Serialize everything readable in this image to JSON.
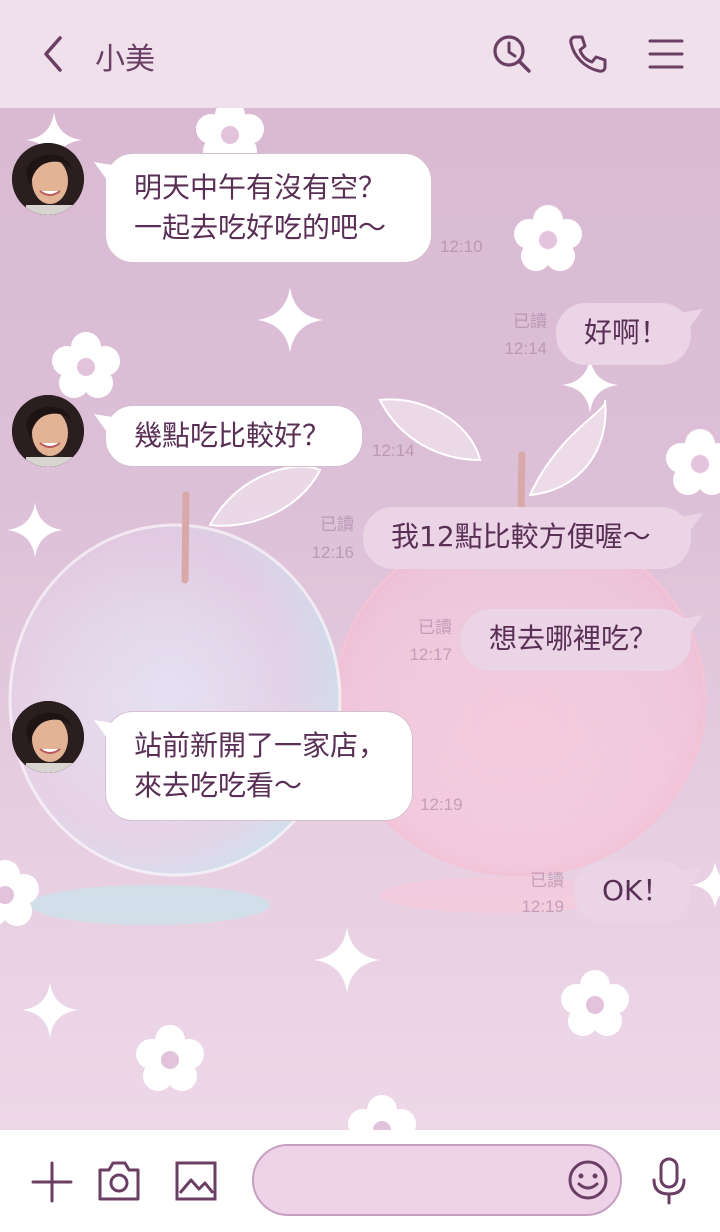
{
  "header": {
    "title": "小美",
    "icons": [
      "back-chevron-icon",
      "search-history-icon",
      "phone-icon",
      "menu-icon"
    ]
  },
  "messages": [
    {
      "side": "in",
      "text": "明天中午有沒有空？\n一起去吃好吃的吧～",
      "time": "12:10"
    },
    {
      "side": "out",
      "text": "好啊！",
      "read": "已讀",
      "time": "12:14"
    },
    {
      "side": "in",
      "text": "幾點吃比較好？",
      "time": "12:14"
    },
    {
      "side": "out",
      "text": "我12點比較方便喔～",
      "read": "已讀",
      "time": "12:16"
    },
    {
      "side": "out",
      "text": "想去哪裡吃？",
      "read": "已讀",
      "time": "12:17"
    },
    {
      "side": "in",
      "text": "站前新開了一家店，\n來去吃吃看～",
      "time": "12:19"
    },
    {
      "side": "out",
      "text": "OK！",
      "read": "已讀",
      "time": "12:19"
    }
  ],
  "footer": {
    "input_placeholder": "",
    "icons": [
      "plus-icon",
      "camera-icon",
      "image-icon",
      "emoji-icon",
      "microphone-icon"
    ]
  },
  "colors": {
    "accent": "#6b3e63",
    "header_bg": "#efe0ec",
    "incoming_bubble": "#ffffff",
    "outgoing_bubble": "#ead4e6",
    "input_bg": "#eed3e8"
  }
}
